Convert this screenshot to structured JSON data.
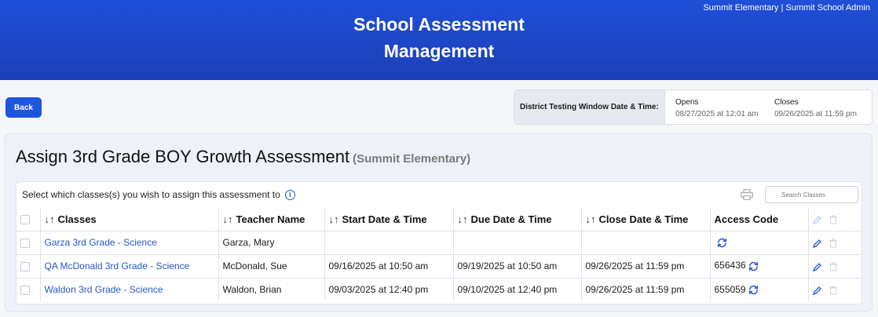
{
  "header": {
    "org": "Summit Elementary | Summit School Admin",
    "title_line1": "School Assessment",
    "title_line2": "Management"
  },
  "back_label": "Back",
  "window": {
    "label": "District Testing Window Date & Time:",
    "opens_label": "Opens",
    "opens_value": "08/27/2025 at 12:01 am",
    "closes_label": "Closes",
    "closes_value": "09/26/2025 at 11:59 pm"
  },
  "panel": {
    "title": "Assign 3rd Grade BOY Growth Assessment",
    "school": "(Summit Elementary)",
    "prompt": "Select which classes(s) you wish to assign this assessment to",
    "search_placeholder": "Search Classes"
  },
  "columns": {
    "classes": "Classes",
    "teacher": "Teacher Name",
    "start": "Start Date & Time",
    "due": "Due Date & Time",
    "close": "Close Date & Time",
    "code": "Access Code"
  },
  "rows": [
    {
      "class": "Garza 3rd Grade - Science",
      "teacher": "Garza, Mary",
      "start": "",
      "due": "",
      "close": "",
      "code": ""
    },
    {
      "class": "QA McDonald 3rd Grade - Science",
      "teacher": "McDonald, Sue",
      "start": "09/16/2025 at 10:50 am",
      "due": "09/19/2025 at 10:50 am",
      "close": "09/26/2025 at 11:59 pm",
      "code": "656436"
    },
    {
      "class": "Waldon 3rd Grade - Science",
      "teacher": "Waldon, Brian",
      "start": "09/03/2025 at 12:40 pm",
      "due": "09/10/2025 at 12:40 pm",
      "close": "09/26/2025 at 11:59 pm",
      "code": "655059"
    }
  ],
  "colors": {
    "header": "#1f4fd8",
    "link": "#2356c9",
    "button": "#1d55e0"
  }
}
